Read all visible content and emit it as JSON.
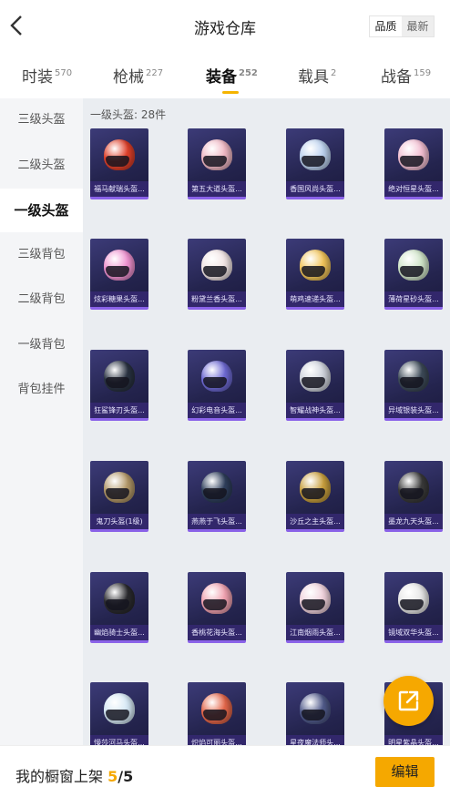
{
  "header": {
    "title": "游戏仓库",
    "sort": {
      "active": "品质",
      "other": "最新"
    }
  },
  "categories": [
    {
      "label": "时装",
      "count": "570"
    },
    {
      "label": "枪械",
      "count": "227"
    },
    {
      "label": "装备",
      "count": "252"
    },
    {
      "label": "载具",
      "count": "2"
    },
    {
      "label": "战备",
      "count": "159"
    }
  ],
  "sidebar": [
    {
      "label": "三级头盔"
    },
    {
      "label": "二级头盔"
    },
    {
      "label": "一级头盔"
    },
    {
      "label": "三级背包"
    },
    {
      "label": "二级背包"
    },
    {
      "label": "一级背包"
    },
    {
      "label": "背包挂件"
    }
  ],
  "section": {
    "title": "一级头盔: 28件"
  },
  "items": [
    {
      "name": "福马献瑞头盔...",
      "color": "#e0402a"
    },
    {
      "name": "第五大道头盔...",
      "color": "#f0b8c4"
    },
    {
      "name": "香国风尚头盔...",
      "color": "#bcd2ef"
    },
    {
      "name": "绝对恒星头盔...",
      "color": "#f3bfd2"
    },
    {
      "name": "炫彩糖果头盔...",
      "color": "#ef92d0"
    },
    {
      "name": "粉黛兰香头盔...",
      "color": "#f1e4e4"
    },
    {
      "name": "萌鸡速递头盔...",
      "color": "#f2c55a"
    },
    {
      "name": "薄荷星砂头盔...",
      "color": "#cfe4c8"
    },
    {
      "name": "狂鲨锋刃头盔...",
      "color": "#2a3342"
    },
    {
      "name": "幻彩电音头盔...",
      "color": "#6e6ad4"
    },
    {
      "name": "智耀战神头盔...",
      "color": "#cfd3dc"
    },
    {
      "name": "异域银装头盔...",
      "color": "#3d4a58"
    },
    {
      "name": "鬼刀头盔(1级)",
      "color": "#b39868"
    },
    {
      "name": "燕燕于飞头盔...",
      "color": "#2f3f5c"
    },
    {
      "name": "沙丘之主头盔...",
      "color": "#c9a03e"
    },
    {
      "name": "墨龙九天头盔...",
      "color": "#3a3a3a"
    },
    {
      "name": "幽焰骑士头盔...",
      "color": "#2b2b2f"
    },
    {
      "name": "香桃花海头盔...",
      "color": "#f0a2b0"
    },
    {
      "name": "江南烟雨头盔...",
      "color": "#f0d2dc"
    },
    {
      "name": "镜域双华头盔...",
      "color": "#e6e6e6"
    },
    {
      "name": "慢莎河马头盔...",
      "color": "#d5e8f5"
    },
    {
      "name": "炽焰可丽头盔...",
      "color": "#e4674a"
    },
    {
      "name": "星夜魔法师头...",
      "color": "#505a8a"
    },
    {
      "name": "明星紫晶头盔...",
      "color": "#8a6fd8"
    }
  ],
  "footer": {
    "label": "我的橱窗上架",
    "current": "5",
    "total": "/5",
    "edit": "编辑"
  }
}
